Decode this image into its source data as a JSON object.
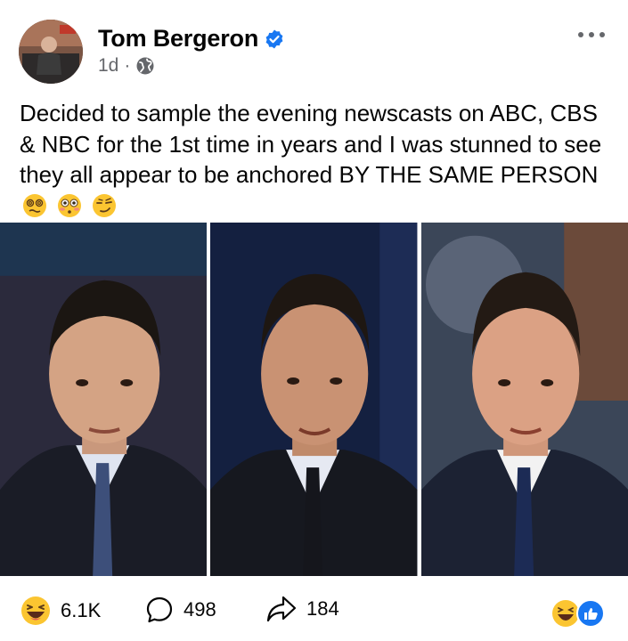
{
  "post": {
    "author": "Tom Bergeron",
    "time": "1d",
    "separator": "·",
    "text": "Decided to sample the evening newscasts on ABC, CBS & NBC for the 1st time in years and I was stunned to see they all appear to be anchored BY THE SAME PERSON",
    "emojis": [
      "woozy-face-icon",
      "flushed-face-icon",
      "smirking-face-icon"
    ]
  },
  "stats": {
    "reactions": "6.1K",
    "comments": "498",
    "shares": "184"
  },
  "photos": [
    {
      "name": "anchor-photo-1",
      "bg": "#2b2a3c",
      "tie": "#3d4f7a"
    },
    {
      "name": "anchor-photo-2",
      "bg": "#142040",
      "tie": "#15161c"
    },
    {
      "name": "anchor-photo-3",
      "bg": "#3b4658",
      "tie": "#1c2b55"
    }
  ],
  "colors": {
    "accent": "#1877f2",
    "muted": "#65676b"
  }
}
